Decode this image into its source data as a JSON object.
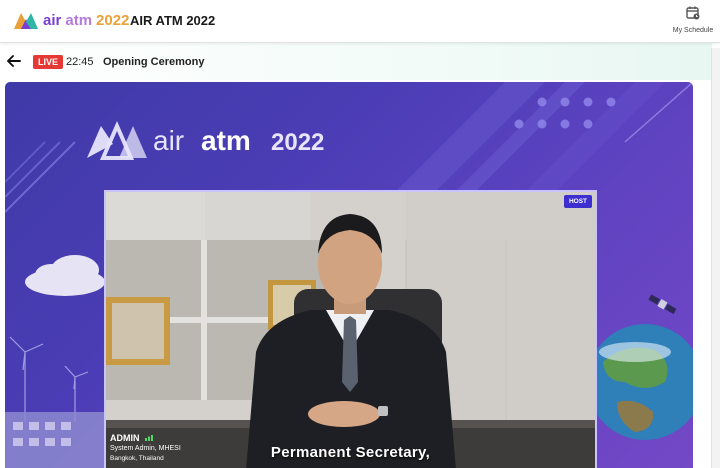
{
  "header": {
    "brand_air": "air",
    "brand_atm": "atm",
    "brand_year": "2022",
    "title": "AIR ATM 2022",
    "schedule_label": "My Schedule"
  },
  "session": {
    "live_badge": "LIVE",
    "time": "22:45",
    "title": "Opening Ceremony"
  },
  "stage": {
    "banner_air": "air",
    "banner_atm": "atm",
    "banner_year": "2022"
  },
  "video": {
    "host_badge": "HOST",
    "speaker_name": "ADMIN",
    "speaker_role": "System Admin, MHESI",
    "speaker_location": "Bangkok, Thailand",
    "caption": "Permanent Secretary,"
  },
  "colors": {
    "live": "#e53935",
    "host": "#3d2ed0",
    "stage_purple": "#4b3db5",
    "brand_purple": "#7a3fd1",
    "brand_year": "#e9a23a"
  }
}
